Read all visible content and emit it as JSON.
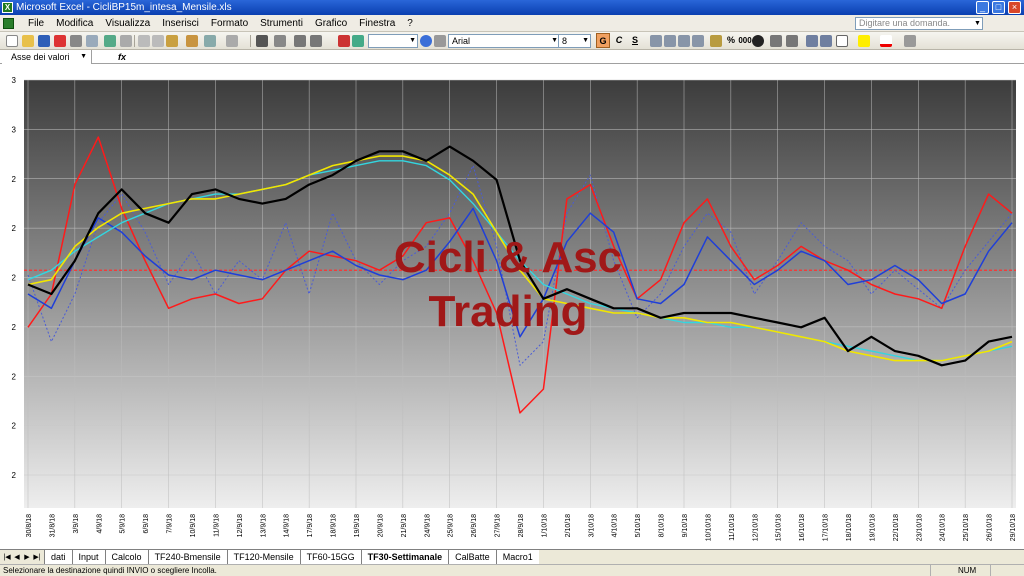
{
  "window": {
    "title": "Microsoft Excel - CicliBP15m_intesa_Mensile.xls",
    "minimize": "_",
    "maximize": "□",
    "close": "×"
  },
  "menu": {
    "items": [
      "File",
      "Modifica",
      "Visualizza",
      "Inserisci",
      "Formato",
      "Strumenti",
      "Grafico",
      "Finestra",
      "?"
    ],
    "ask_placeholder": "Digitare una domanda.",
    "doc_buttons": [
      "_",
      "□",
      "×"
    ]
  },
  "toolbar": {
    "font_name": "Arial",
    "font_size": "8",
    "bold": "G",
    "italic": "C",
    "underline": "S",
    "percent": "%",
    "thousands": "000"
  },
  "formula_bar": {
    "name_box": "Asse dei valori",
    "fx": "fx"
  },
  "chart": {
    "watermark_line1": "Cicli & Asc",
    "watermark_line2": "Trading",
    "y_ticks": [
      "3",
      "3",
      "2",
      "2",
      "2",
      "2",
      "2",
      "2",
      "2"
    ],
    "x_ticks": [
      "30/8/18",
      "31/8/18",
      "3/9/18",
      "4/9/18",
      "5/9/18",
      "6/9/18",
      "7/9/18",
      "10/9/18",
      "11/9/18",
      "12/9/18",
      "13/9/18",
      "14/9/18",
      "17/9/18",
      "18/9/18",
      "19/9/18",
      "20/9/18",
      "21/9/18",
      "24/9/18",
      "25/9/18",
      "26/9/18",
      "27/9/18",
      "28/9/18",
      "1/10/18",
      "2/10/18",
      "3/10/18",
      "4/10/18",
      "5/10/18",
      "8/10/18",
      "9/10/18",
      "10/10/18",
      "11/10/18",
      "12/10/18",
      "15/10/18",
      "16/10/18",
      "17/10/18",
      "18/10/18",
      "19/10/18",
      "22/10/18",
      "23/10/18",
      "24/10/18",
      "25/10/18",
      "26/10/18",
      "29/10/18"
    ],
    "colors": {
      "price": "#000000",
      "red": "#ff1a1a",
      "blue": "#1f3fd8",
      "yellow": "#f2e600",
      "cyan": "#33d6e0",
      "dotted": "#4a5cd6",
      "watermark": "#a01818"
    }
  },
  "chart_data": {
    "type": "line",
    "x": [
      "30/8/18",
      "31/8/18",
      "3/9/18",
      "4/9/18",
      "5/9/18",
      "6/9/18",
      "7/9/18",
      "10/9/18",
      "11/9/18",
      "12/9/18",
      "13/9/18",
      "14/9/18",
      "17/9/18",
      "18/9/18",
      "19/9/18",
      "20/9/18",
      "21/9/18",
      "24/9/18",
      "25/9/18",
      "26/9/18",
      "27/9/18",
      "28/9/18",
      "1/10/18",
      "2/10/18",
      "3/10/18",
      "4/10/18",
      "5/10/18",
      "8/10/18",
      "9/10/18",
      "10/10/18",
      "11/10/18",
      "12/10/18",
      "15/10/18",
      "16/10/18",
      "17/10/18",
      "18/10/18",
      "19/10/18",
      "22/10/18",
      "23/10/18",
      "24/10/18",
      "25/10/18",
      "26/10/18",
      "29/10/18"
    ],
    "ylim": [
      2.0,
      2.9
    ],
    "y_tick_labels": [
      "3",
      "3",
      "2",
      "2",
      "2",
      "2",
      "2",
      "2",
      "2"
    ],
    "grid": true,
    "legend": "none",
    "reference_line": 2.5,
    "series": [
      {
        "values": [
          2.47,
          2.45,
          2.52,
          2.62,
          2.67,
          2.62,
          2.6,
          2.66,
          2.67,
          2.65,
          2.64,
          2.65,
          2.68,
          2.7,
          2.73,
          2.75,
          2.75,
          2.73,
          2.76,
          2.73,
          2.69,
          2.52,
          2.44,
          2.46,
          2.44,
          2.42,
          2.42,
          2.4,
          2.41,
          2.41,
          2.41,
          2.4,
          2.39,
          2.38,
          2.4,
          2.33,
          2.36,
          2.33,
          2.32,
          2.3,
          2.31,
          2.35,
          2.36
        ]
      },
      {
        "values": [
          2.38,
          2.45,
          2.68,
          2.78,
          2.63,
          2.52,
          2.42,
          2.44,
          2.45,
          2.43,
          2.44,
          2.5,
          2.54,
          2.53,
          2.52,
          2.5,
          2.53,
          2.6,
          2.61,
          2.52,
          2.41,
          2.2,
          2.25,
          2.65,
          2.68,
          2.55,
          2.44,
          2.48,
          2.6,
          2.65,
          2.55,
          2.48,
          2.51,
          2.55,
          2.52,
          2.5,
          2.47,
          2.45,
          2.44,
          2.42,
          2.55,
          2.66,
          2.62
        ]
      },
      {
        "values": [
          2.45,
          2.42,
          2.52,
          2.61,
          2.58,
          2.53,
          2.49,
          2.48,
          2.5,
          2.49,
          2.48,
          2.5,
          2.52,
          2.54,
          2.51,
          2.49,
          2.48,
          2.5,
          2.56,
          2.63,
          2.52,
          2.36,
          2.44,
          2.56,
          2.62,
          2.58,
          2.44,
          2.43,
          2.47,
          2.57,
          2.52,
          2.47,
          2.5,
          2.54,
          2.52,
          2.47,
          2.48,
          2.51,
          2.48,
          2.43,
          2.45,
          2.54,
          2.6
        ]
      },
      {
        "values": [
          2.47,
          2.48,
          2.55,
          2.59,
          2.62,
          2.63,
          2.64,
          2.65,
          2.65,
          2.66,
          2.67,
          2.68,
          2.7,
          2.72,
          2.73,
          2.74,
          2.74,
          2.73,
          2.7,
          2.66,
          2.58,
          2.5,
          2.44,
          2.43,
          2.42,
          2.41,
          2.41,
          2.4,
          2.4,
          2.39,
          2.39,
          2.38,
          2.37,
          2.36,
          2.35,
          2.33,
          2.32,
          2.31,
          2.31,
          2.31,
          2.32,
          2.33,
          2.35
        ]
      },
      {
        "values": [
          2.48,
          2.5,
          2.54,
          2.57,
          2.6,
          2.62,
          2.64,
          2.65,
          2.66,
          2.66,
          2.67,
          2.68,
          2.7,
          2.71,
          2.72,
          2.73,
          2.73,
          2.72,
          2.69,
          2.64,
          2.58,
          2.52,
          2.47,
          2.45,
          2.43,
          2.42,
          2.41,
          2.4,
          2.39,
          2.39,
          2.38,
          2.38,
          2.37,
          2.36,
          2.35,
          2.34,
          2.33,
          2.32,
          2.31,
          2.31,
          2.32,
          2.33,
          2.34
        ]
      },
      {
        "values": [
          2.49,
          2.35,
          2.45,
          2.6,
          2.66,
          2.58,
          2.47,
          2.54,
          2.45,
          2.52,
          2.48,
          2.6,
          2.45,
          2.62,
          2.52,
          2.47,
          2.52,
          2.55,
          2.62,
          2.72,
          2.55,
          2.3,
          2.35,
          2.62,
          2.7,
          2.52,
          2.4,
          2.45,
          2.55,
          2.62,
          2.58,
          2.45,
          2.52,
          2.6,
          2.55,
          2.52,
          2.45,
          2.5,
          2.46,
          2.42,
          2.5,
          2.56,
          2.62
        ]
      }
    ]
  },
  "sheet_tabs": [
    "dati",
    "Input",
    "Calcolo",
    "TF240-Bmensile",
    "TF120-Mensile",
    "TF60-15GG",
    "TF30-Settimanale",
    "CalBatte",
    "Macro1"
  ],
  "active_tab": "TF30-Settimanale",
  "tab_nav": [
    "|◀",
    "◀",
    "▶",
    "▶|"
  ],
  "status": {
    "message": "Selezionare la destinazione quindi INVIO o scegliere Incolla.",
    "num": "NUM"
  }
}
